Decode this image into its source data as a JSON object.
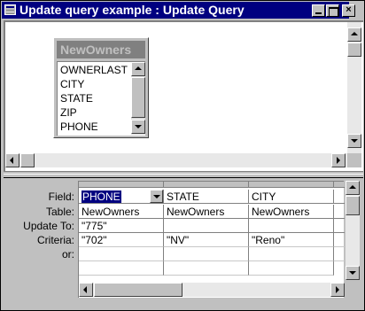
{
  "window": {
    "title": "Update query example : Update Query",
    "close_glyph": "×"
  },
  "field_list": {
    "title": "NewOwners",
    "items": [
      "OWNERLASTN",
      "CITY",
      "STATE",
      "ZIP",
      "PHONE"
    ]
  },
  "grid": {
    "row_labels": [
      "Field:",
      "Table:",
      "Update To:",
      "Criteria:",
      "or:"
    ],
    "columns": [
      {
        "field": "PHONE",
        "table": "NewOwners",
        "update_to": "\"775\"",
        "criteria": "\"702\"",
        "or": ""
      },
      {
        "field": "STATE",
        "table": "NewOwners",
        "update_to": "",
        "criteria": "\"NV\"",
        "or": ""
      },
      {
        "field": "CITY",
        "table": "NewOwners",
        "update_to": "",
        "criteria": "\"Reno\"",
        "or": ""
      },
      {
        "field": "",
        "table": "",
        "update_to": "",
        "criteria": "",
        "or": ""
      }
    ]
  },
  "colors": {
    "title_bar": "#000080",
    "highlight": "#000080",
    "face": "#c0c0c0"
  }
}
